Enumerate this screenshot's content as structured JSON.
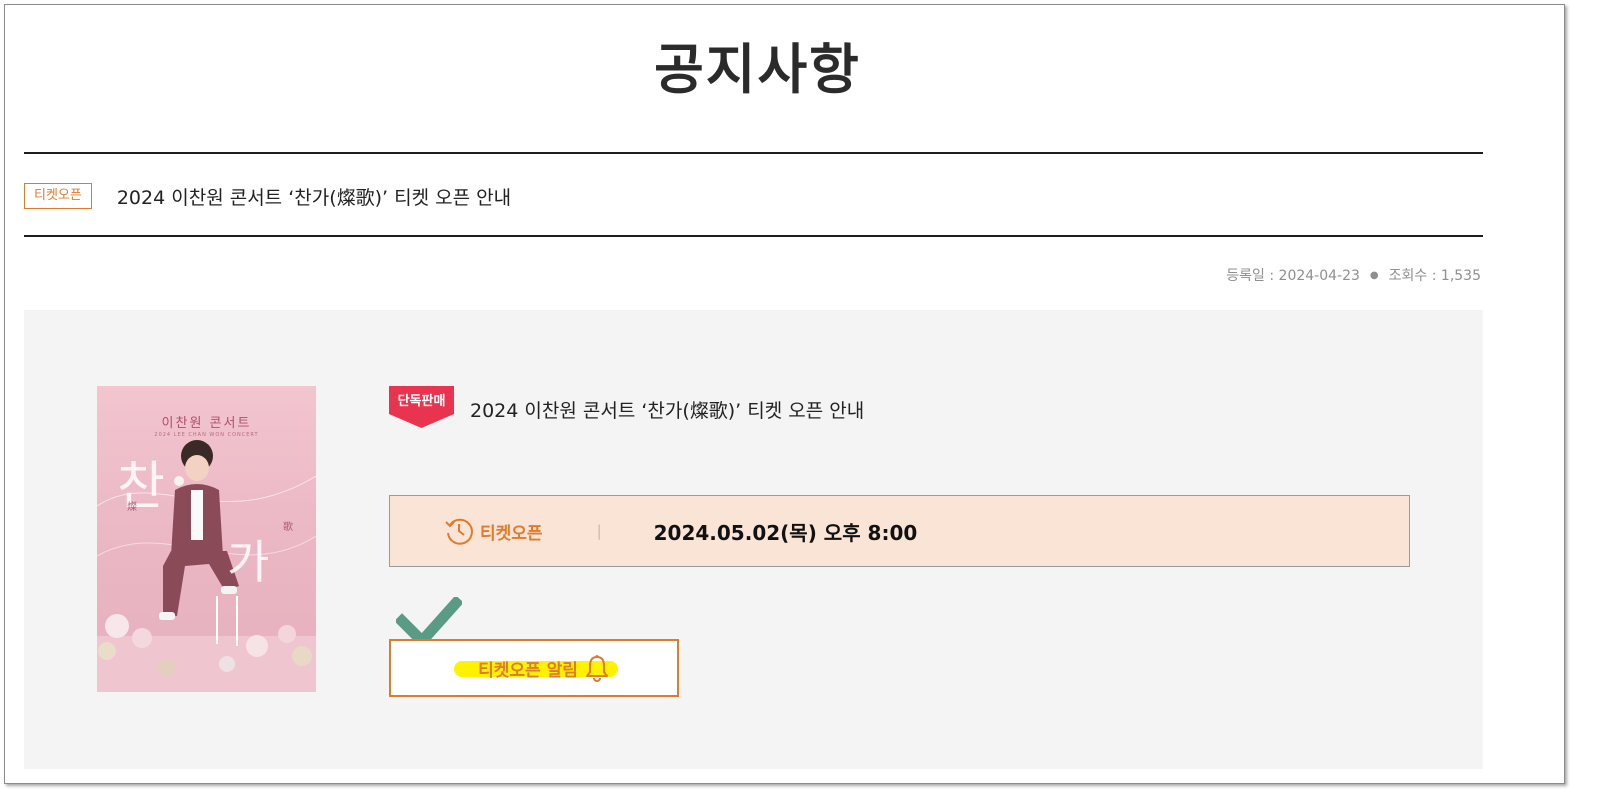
{
  "page": {
    "title": "공지사항"
  },
  "notice": {
    "category": "티켓오픈",
    "title": "2024 이찬원 콘서트 ‘찬가(燦歌)’ 티켓 오픈 안내",
    "meta": {
      "registered_label": "등록일 : 2024-04-23",
      "views_label": "조회수 : 1,535"
    }
  },
  "detail": {
    "badge": "단독판매",
    "title": "2024 이찬원 콘서트 ‘찬가(燦歌)’ 티켓 오픈 안내",
    "poster": {
      "title": "이찬원 콘서트",
      "subtitle": "2024 LEE CHAN WON CONCERT",
      "big_char_1": "찬",
      "big_char_2": "가",
      "hanja_1": "燦",
      "hanja_2": "歌"
    },
    "open": {
      "label": "티켓오픈",
      "separator": "|",
      "date": "2024.05.02(목) 오후 8:00"
    },
    "alarm_button": {
      "label": "티켓오픈 알림"
    }
  },
  "colors": {
    "accent": "#e07b2c",
    "badge_red": "#e8344e",
    "open_bg": "#f9e4d6",
    "content_bg": "#f4f4f4",
    "highlight": "#fff200",
    "check": "#5a9b86"
  },
  "icons": {
    "open_icon": "clock-history-icon",
    "alarm_icon": "bell-icon",
    "check_icon": "checkmark-icon"
  }
}
